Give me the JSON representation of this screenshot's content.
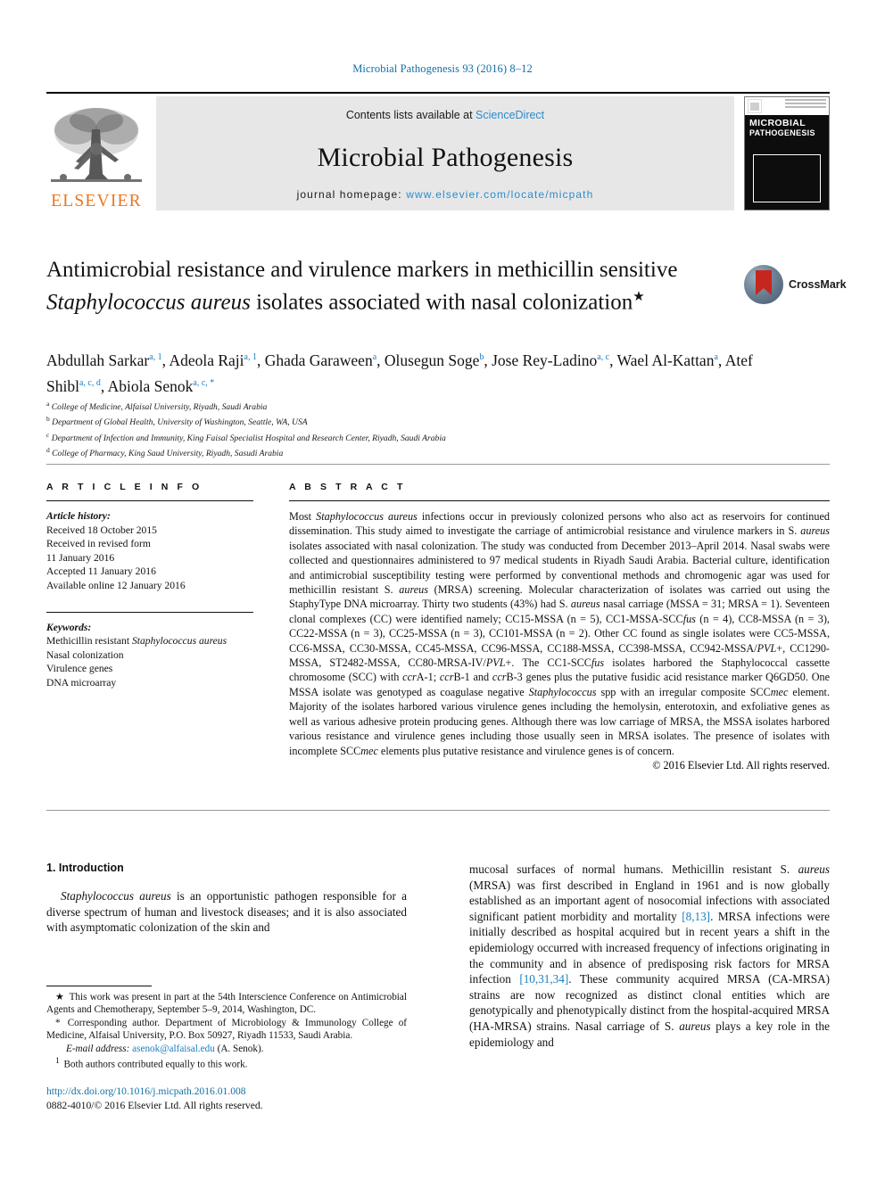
{
  "running_head": "Microbial Pathogenesis 93 (2016) 8–12",
  "masthead": {
    "publisher_logo_label": "ELSEVIER",
    "contents_prefix": "Contents lists available at ",
    "contents_link": "ScienceDirect",
    "journal_name": "Microbial Pathogenesis",
    "homepage_prefix": "journal homepage: ",
    "homepage_url": "www.elsevier.com/locate/micpath",
    "cover": {
      "title_line1": "MICROBIAL",
      "title_line2": "PATHOGENESIS"
    }
  },
  "crossmark": {
    "label": "CrossMark"
  },
  "article": {
    "title_part1": "Antimicrobial resistance and virulence markers in methicillin sensitive ",
    "title_italic": "Staphylococcus aureus",
    "title_part2": " isolates associated with nasal colonization",
    "title_star": "★",
    "authors_line1": "Abdullah Sarkar",
    "authors_line1_marks": "a, 1",
    "authors": [
      {
        "name": "Abdullah Sarkar",
        "marks": "a, 1"
      },
      {
        "name": "Adeola Raji",
        "marks": "a, 1"
      },
      {
        "name": "Ghada Garaween",
        "marks": "a"
      },
      {
        "name": "Olusegun Soge",
        "marks": "b"
      },
      {
        "name": "Jose Rey-Ladino",
        "marks": "a, c"
      },
      {
        "name": "Wael Al-Kattan",
        "marks": "a"
      },
      {
        "name": "Atef Shibl",
        "marks": "a, c, d"
      },
      {
        "name": "Abiola Senok",
        "marks": "a, c, *"
      }
    ],
    "affiliations": [
      {
        "mark": "a",
        "text": "College of Medicine, Alfaisal University, Riyadh, Saudi Arabia"
      },
      {
        "mark": "b",
        "text": "Department of Global Health, University of Washington, Seattle, WA, USA"
      },
      {
        "mark": "c",
        "text": "Department of Infection and Immunity, King Faisal Specialist Hospital and Research Center, Riyadh, Saudi Arabia"
      },
      {
        "mark": "d",
        "text": "College of Pharmacy, King Saud University, Riyadh, Sasudi Arabia"
      }
    ]
  },
  "article_info": {
    "heading": "A R T I C L E   I N F O",
    "history_label": "Article history:",
    "history": [
      "Received 18 October 2015",
      "Received in revised form",
      "11 January 2016",
      "Accepted 11 January 2016",
      "Available online 12 January 2016"
    ],
    "keywords_label": "Keywords:",
    "keywords": [
      "Methicillin resistant Staphylococcus aureus",
      "Nasal colonization",
      "Virulence genes",
      "DNA microarray"
    ]
  },
  "abstract": {
    "heading": "A B S T R A C T",
    "text": "Most Staphylococcus aureus infections occur in previously colonized persons who also act as reservoirs for continued dissemination. This study aimed to investigate the carriage of antimicrobial resistance and virulence markers in S. aureus isolates associated with nasal colonization. The study was conducted from December 2013–April 2014. Nasal swabs were collected and questionnaires administered to 97 medical students in Riyadh Saudi Arabia. Bacterial culture, identification and antimicrobial susceptibility testing were performed by conventional methods and chromogenic agar was used for methicillin resistant S. aureus (MRSA) screening. Molecular characterization of isolates was carried out using the StaphyType DNA microarray. Thirty two students (43%) had S. aureus nasal carriage (MSSA = 31; MRSA = 1). Seventeen clonal complexes (CC) were identified namely; CC15-MSSA (n = 5), CC1-MSSA-SCCfus (n = 4), CC8-MSSA (n = 3), CC22-MSSA (n = 3), CC25-MSSA (n = 3), CC101-MSSA (n = 2). Other CC found as single isolates were CC5-MSSA, CC6-MSSA, CC30-MSSA, CC45-MSSA, CC96-MSSA, CC188-MSSA, CC398-MSSA, CC942-MSSA/PVL+, CC1290-MSSA, ST2482-MSSA, CC80-MRSA-IV/PVL+. The CC1-SCCfus isolates harbored the Staphylococcal cassette chromosome (SCC) with ccrA-1; ccrB-1 and ccrB-3 genes plus the putative fusidic acid resistance marker Q6GD50. One MSSA isolate was genotyped as coagulase negative Staphylococcus spp with an irregular composite SCCmec element. Majority of the isolates harbored various virulence genes including the hemolysin, enterotoxin, and exfoliative genes as well as various adhesive protein producing genes. Although there was low carriage of MRSA, the MSSA isolates harbored various resistance and virulence genes including those usually seen in MRSA isolates. The presence of isolates with incomplete SCCmec elements plus putative resistance and virulence genes is of concern.",
    "copyright": "© 2016 Elsevier Ltd. All rights reserved."
  },
  "introduction": {
    "heading": "1. Introduction",
    "left_paragraph": "Staphylococcus aureus is an opportunistic pathogen responsible for a diverse spectrum of human and livestock diseases; and it is also associated with asymptomatic colonization of the skin and",
    "right_paragraph_1": "mucosal surfaces of normal humans. Methicillin resistant S. aureus (MRSA) was first described in England in 1961 and is now globally established as an important agent of nosocomial infections with associated significant patient morbidity and mortality ",
    "right_ref_1": "[8,13]",
    "right_paragraph_2": ". MRSA infections were initially described as hospital acquired but in recent years a shift in the epidemiology occurred with increased frequency of infections originating in the community and in absence of predisposing risk factors for MRSA infection ",
    "right_ref_2": "[10,31,34]",
    "right_paragraph_3": ". These community acquired MRSA (CA-MRSA) strains are now recognized as distinct clonal entities which are genotypically and phenotypically distinct from the hospital-acquired MRSA (HA-MRSA) strains. Nasal carriage of S. aureus plays a key role in the epidemiology and"
  },
  "footnotes": {
    "star_note_mark": "★",
    "star_note": "This work was present in part at the 54th Interscience Conference on Antimicrobial Agents and Chemotherapy, September 5–9, 2014, Washington, DC.",
    "corresponding_mark": "*",
    "corresponding_note": "Corresponding author. Department of Microbiology & Immunology College of Medicine, Alfaisal University, P.O. Box 50927, Riyadh 11533, Saudi Arabia.",
    "email_label": "E-mail address:",
    "email": "asenok@alfaisal.edu",
    "email_suffix": " (A. Senok).",
    "equal_mark": "1",
    "equal_note": "Both authors contributed equally to this work."
  },
  "doi_block": {
    "doi_url": "http://dx.doi.org/10.1016/j.micpath.2016.01.008",
    "issn_line": "0882-4010/© 2016 Elsevier Ltd. All rights reserved."
  },
  "colors": {
    "link_blue": "#1b7fbf",
    "header_blue": "#1170a6",
    "elsevier_orange": "#e87722",
    "band_gray": "#e7e7e7"
  }
}
